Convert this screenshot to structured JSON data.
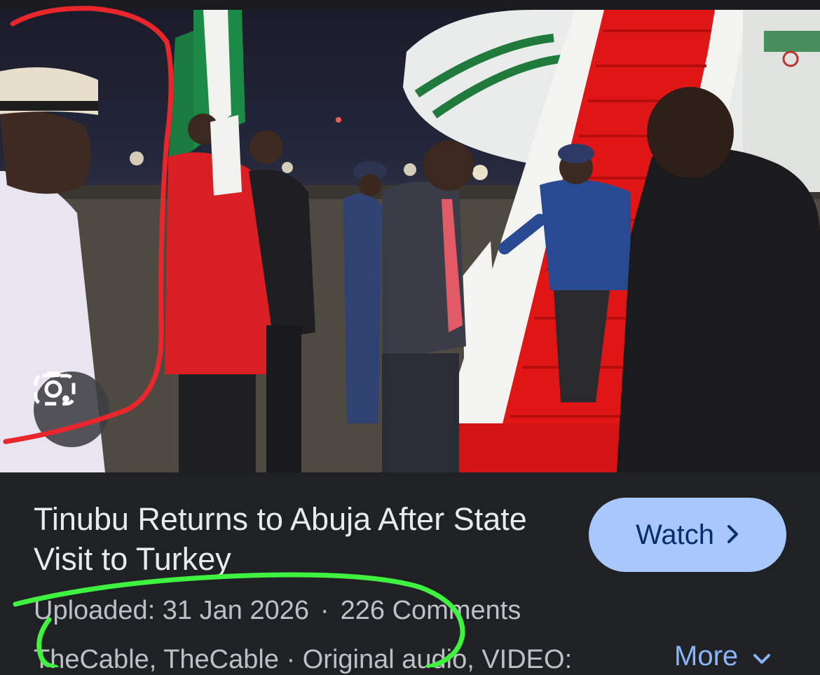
{
  "video": {
    "title": "Tinubu Returns to Abuja After State Visit to Turkey",
    "watch_label": "Watch",
    "uploaded": "Uploaded: 31 Jan 2026",
    "separator": "·",
    "comments": "226 Comments",
    "source_line": "TheCable, TheCable · Original audio, VIDEO:",
    "more_label": "More",
    "lens_icon": "google-lens-icon",
    "watch_icon": "chevron-right-icon",
    "more_icon": "chevron-down-icon"
  },
  "colors": {
    "background": "#202124",
    "watch_button": "#a8c7fa",
    "watch_text": "#062e6f",
    "link": "#8ab4f8",
    "annotation_red": "#e8262b",
    "annotation_green": "#3ff23f"
  }
}
